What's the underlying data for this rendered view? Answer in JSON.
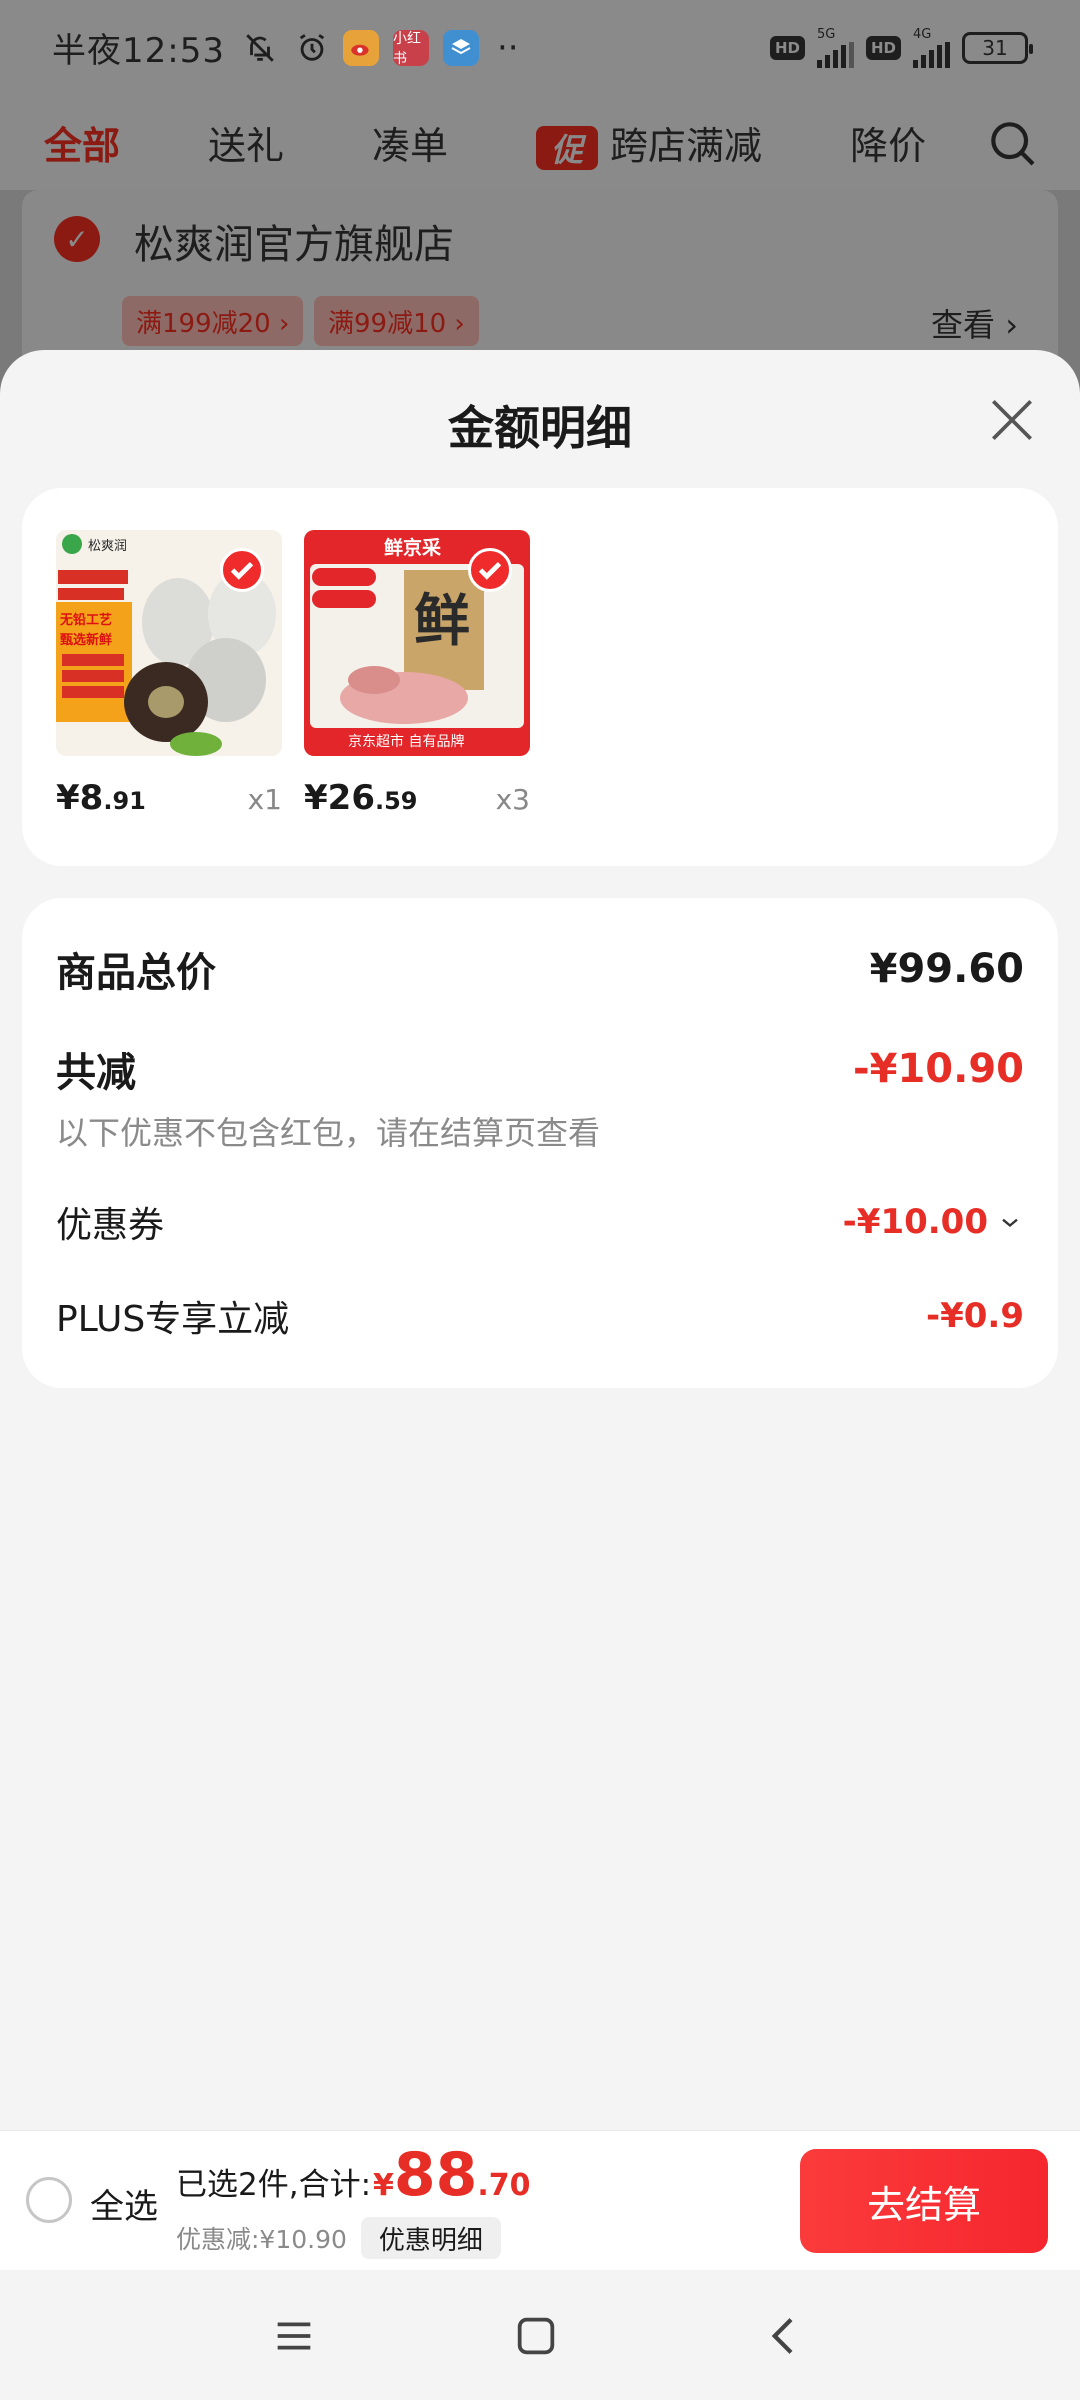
{
  "status_bar": {
    "time": "半夜12:53",
    "icons": [
      "bell-off-icon",
      "alarm-icon",
      "weibo-app-icon",
      "xiaohongshu-app-icon",
      "layers-app-icon",
      "more-dots-icon"
    ],
    "app_badge_text": "小红书",
    "hd_label": "HD",
    "network_1": "5G",
    "network_2": "4G",
    "battery": "31"
  },
  "tabs": {
    "items": [
      "全部",
      "送礼",
      "凑单",
      "跨店满减",
      "降价"
    ],
    "promo_badge": "促",
    "active": "全部"
  },
  "store": {
    "name": "松爽润官方旗舰店",
    "coupons": [
      "满199减20 ›",
      "满99减10 ›"
    ],
    "see_more": "查看 ›"
  },
  "sheet": {
    "title": "金额明细",
    "goods": [
      {
        "price_int": "¥8",
        "price_dec": ".91",
        "qty": "x1",
        "image": "preserved-egg-product"
      },
      {
        "price_int": "¥26",
        "price_dec": ".59",
        "qty": "x3",
        "image": "pork-ribs-product"
      }
    ],
    "image_texts": {
      "brand_1": "松爽润",
      "tag_1": "无铅工艺",
      "tag_2": "甄选新鲜",
      "brand_2": "鲜京采",
      "char_2": "鲜",
      "footer_2": "京东超市 自有品牌"
    },
    "summary": {
      "total_label": "商品总价",
      "total_value": "¥99.60",
      "reduce_label": "共减",
      "reduce_value": "-¥10.90",
      "note": "以下优惠不包含红包，请在结算页查看",
      "coupon_label": "优惠券",
      "coupon_value": "-¥10.00",
      "plus_label": "PLUS专享立减",
      "plus_value": "-¥0.9"
    }
  },
  "checkout": {
    "select_all": "全选",
    "selected_text": "已选2件,合计:",
    "currency": "¥",
    "total_int": "88",
    "total_dec": ".70",
    "discount_text": "优惠减:¥10.90",
    "detail_button": "优惠明细",
    "submit_button": "去结算"
  },
  "colors": {
    "accent_red": "#e62e26",
    "button_red": "#f5262e",
    "sheet_bg": "#f4f4f4"
  }
}
